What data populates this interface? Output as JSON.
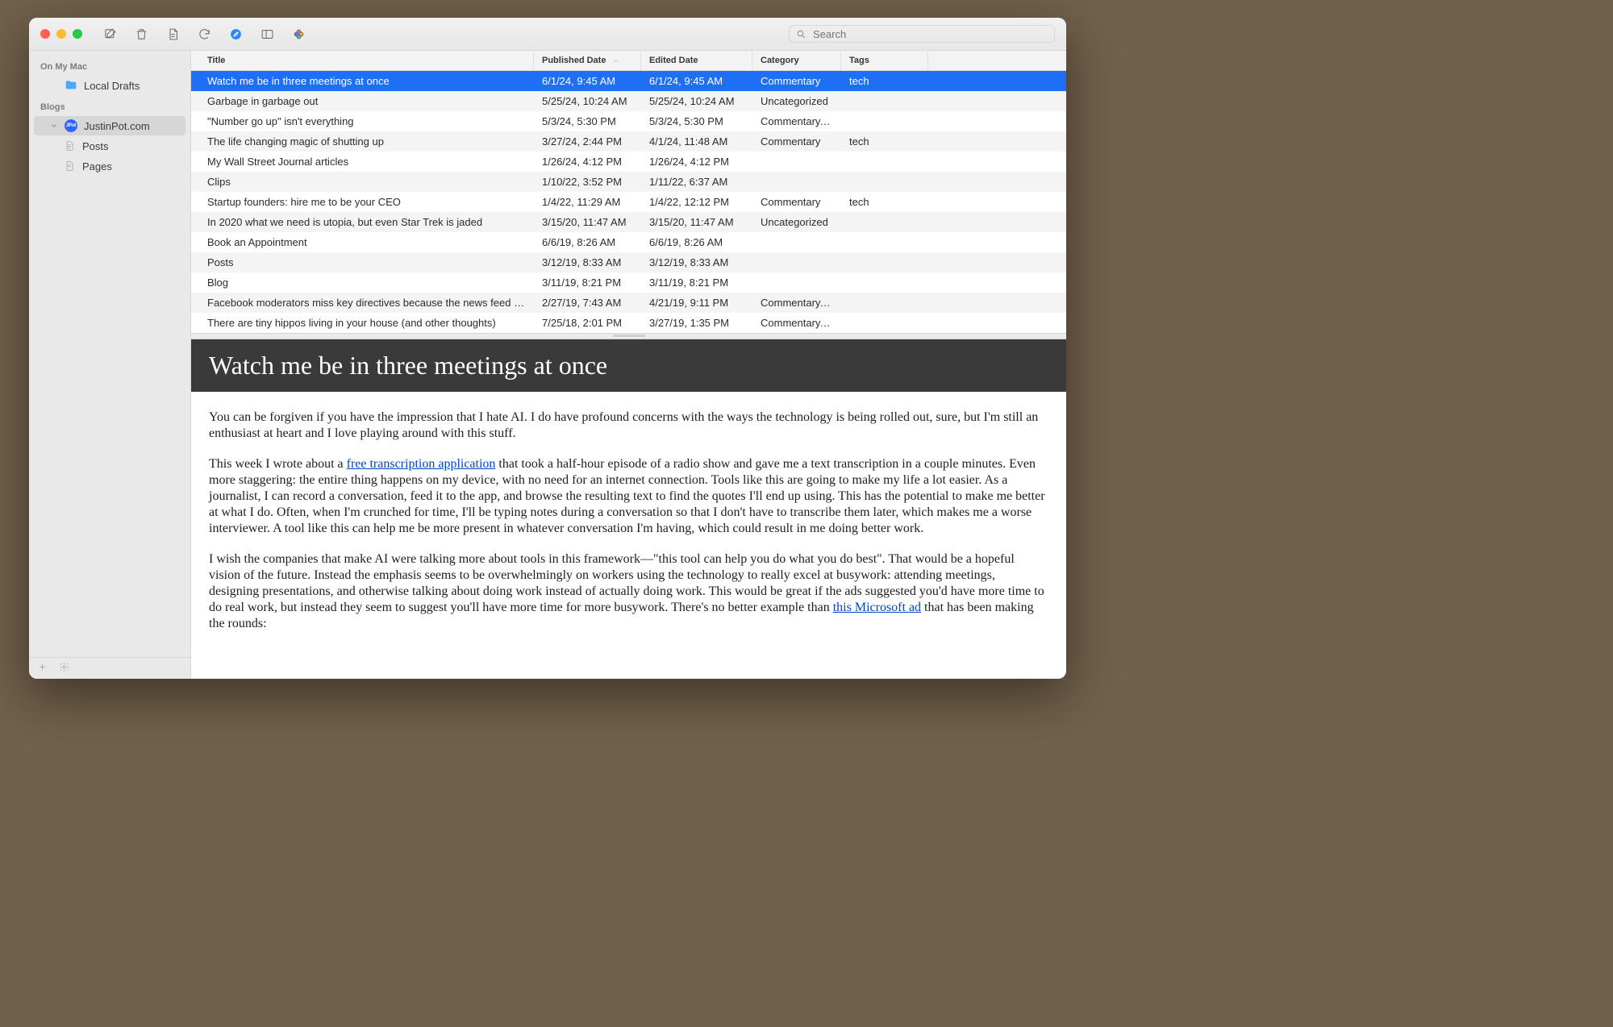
{
  "search": {
    "placeholder": "Search"
  },
  "sidebar": {
    "sections": {
      "onMyMac": {
        "header": "On My Mac",
        "localDrafts": "Local Drafts"
      },
      "blogs": {
        "header": "Blogs",
        "justinpot": "JustinPot.com",
        "posts": "Posts",
        "pages": "Pages"
      }
    }
  },
  "table": {
    "columns": {
      "title": "Title",
      "published": "Published Date",
      "edited": "Edited Date",
      "category": "Category",
      "tags": "Tags"
    },
    "rows": [
      {
        "title": "Watch me be in three meetings at once",
        "published": "6/1/24, 9:45 AM",
        "edited": "6/1/24, 9:45 AM",
        "category": "Commentary",
        "tags": "tech",
        "selected": true
      },
      {
        "title": "Garbage in garbage out",
        "published": "5/25/24, 10:24 AM",
        "edited": "5/25/24, 10:24 AM",
        "category": "Uncategorized",
        "tags": ""
      },
      {
        "title": "\"Number go up\" isn't everything",
        "published": "5/3/24, 5:30 PM",
        "edited": "5/3/24, 5:30 PM",
        "category": "Commentary, I…",
        "tags": ""
      },
      {
        "title": "The life changing magic of shutting up",
        "published": "3/27/24, 2:44 PM",
        "edited": "4/1/24, 11:48 AM",
        "category": "Commentary",
        "tags": "tech"
      },
      {
        "title": "My Wall Street Journal articles",
        "published": "1/26/24, 4:12 PM",
        "edited": "1/26/24, 4:12 PM",
        "category": "",
        "tags": ""
      },
      {
        "title": "Clips",
        "published": "1/10/22, 3:52 PM",
        "edited": "1/11/22, 6:37 AM",
        "category": "",
        "tags": ""
      },
      {
        "title": "Startup founders: hire me to be your CEO",
        "published": "1/4/22, 11:29 AM",
        "edited": "1/4/22, 12:12 PM",
        "category": "Commentary",
        "tags": "tech"
      },
      {
        "title": "In 2020 what we need is utopia, but even Star Trek is jaded",
        "published": "3/15/20, 11:47 AM",
        "edited": "3/15/20, 11:47 AM",
        "category": "Uncategorized",
        "tags": ""
      },
      {
        "title": "Book an Appointment",
        "published": "6/6/19, 8:26 AM",
        "edited": "6/6/19, 8:26 AM",
        "category": "",
        "tags": ""
      },
      {
        "title": "Posts",
        "published": "3/12/19, 8:33 AM",
        "edited": "3/12/19, 8:33 AM",
        "category": "",
        "tags": ""
      },
      {
        "title": "Blog",
        "published": "3/11/19, 8:21 PM",
        "edited": "3/11/19, 8:21 PM",
        "category": "",
        "tags": ""
      },
      {
        "title": "Facebook moderators miss key directives because the news feed is…",
        "published": "2/27/19, 7:43 AM",
        "edited": "4/21/19, 9:11 PM",
        "category": "Commentary, I…",
        "tags": ""
      },
      {
        "title": "There are tiny hippos living in your house (and other thoughts)",
        "published": "7/25/18, 2:01 PM",
        "edited": "3/27/19, 1:35 PM",
        "category": "Commentary, I…",
        "tags": ""
      }
    ]
  },
  "preview": {
    "title": "Watch me be in three meetings at once",
    "p1": "You can be forgiven if you have the impression that I hate AI. I do have profound concerns with the ways the technology is being rolled out, sure, but I'm still an enthusiast at heart and I love playing around with this stuff.",
    "p2a": "This week I wrote about a ",
    "p2link": "free transcription application",
    "p2b": " that took a half-hour episode of a radio show and gave me a text transcription in a couple minutes. Even more staggering: the entire thing happens on my device, with no need for an internet connection. Tools like this are going to make my life a lot easier. As a journalist, I can record a conversation, feed it to the app, and browse the resulting text to find the quotes I'll end up using. This has the potential to make me better at what I do. Often, when I'm crunched for time, I'll be typing notes during a conversation so that I don't have to transcribe them later, which makes me a worse interviewer. A tool like this can help me be more present in whatever conversation I'm having, which could result in me doing better work.",
    "p3a": "I wish the companies that make AI were talking more about tools in this framework—\"this tool can help you do what you do best\". That would be a hopeful vision of the future. Instead the emphasis seems to be overwhelmingly on workers using the technology to really excel at busywork: attending meetings, designing presentations, and otherwise talking about doing work instead of actually doing work. This would be great if the ads suggested you'd have more time to do real work, but instead they seem to suggest you'll have more time for more busywork. There's no better example than ",
    "p3link": "this Microsoft ad",
    "p3b": " that has been making the rounds:"
  }
}
